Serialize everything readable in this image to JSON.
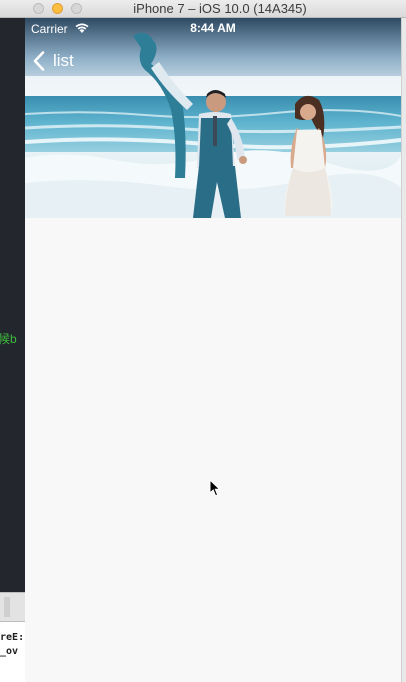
{
  "window": {
    "title": "iPhone 7 – iOS 10.0 (14A345)"
  },
  "ide": {
    "code_fragment": "时候b",
    "console_line_1": "ureE:",
    "console_line_2": "e_ov"
  },
  "status_bar": {
    "carrier": "Carrier",
    "time": "8:44 AM",
    "wifi_icon": "wifi-icon"
  },
  "nav": {
    "back_label": "list",
    "back_icon": "chevron-left-icon"
  },
  "header_image": {
    "subject": "couple-on-beach-photo"
  },
  "colors": {
    "titlebar_minimize": "#fdbd41",
    "nav_text": "#ffffff",
    "content_background": "#f8f8f8",
    "ide_green_text": "#3bbd3b"
  }
}
